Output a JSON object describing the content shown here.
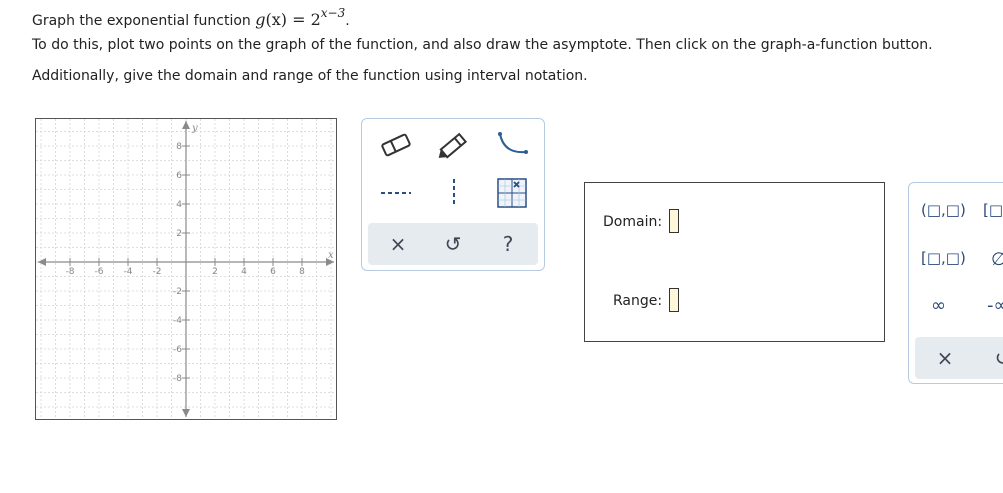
{
  "question": {
    "line1_prefix": "Graph the exponential function ",
    "function_name": "g",
    "function_var": "(x)",
    "equals": " = 2",
    "exponent": "x−3",
    "line1_suffix": ".",
    "line2": "To do this, plot two points on the graph of the function, and also draw the asymptote. Then click on the graph-a-function button.",
    "line3": "Additionally, give the domain and range of the function using interval notation."
  },
  "graph": {
    "x_axis_label": "x",
    "y_axis_label": "y",
    "x_ticks": [
      "-8",
      "-6",
      "-4",
      "-2",
      "2",
      "4",
      "6",
      "8"
    ],
    "y_ticks": [
      "8",
      "6",
      "4",
      "2",
      "-2",
      "-4",
      "-6",
      "-8"
    ]
  },
  "toolbox": {
    "tools": [
      "eraser-icon",
      "pencil-icon",
      "curve-icon",
      "dashed-line-icon",
      "vertical-dashed-line-icon",
      "graph-function-icon"
    ],
    "clear_label": "×",
    "undo_label": "↺",
    "help_label": "?"
  },
  "answer": {
    "domain_label": "Domain:",
    "range_label": "Range:"
  },
  "palette": {
    "open_open": "(□,□)",
    "closed_open_partial": "[□,",
    "closed_open": "[□,□)",
    "empty_set": "∅",
    "infinity": "∞",
    "neg_infinity_partial": "-∞",
    "clear_label": "×",
    "undo_label": "↺"
  }
}
